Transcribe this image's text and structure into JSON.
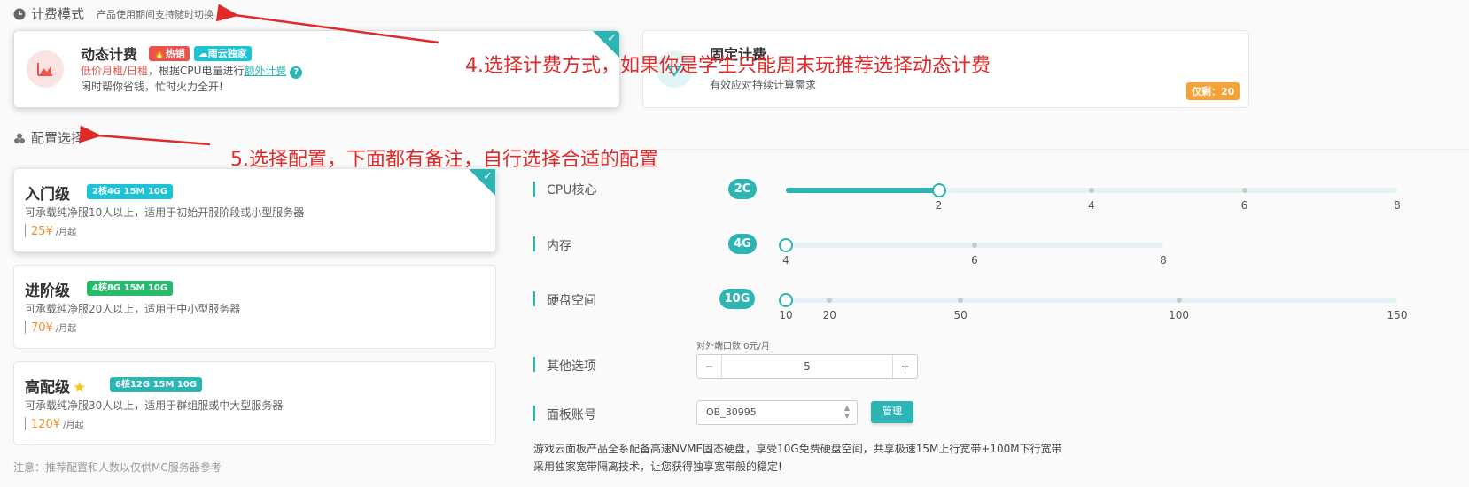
{
  "billing": {
    "title": "计费模式",
    "subtitle": "产品使用期间支持随时切换",
    "dynamic": {
      "name": "动态计费",
      "hot_tag": "热销",
      "exclusive_tag": "雨云独家",
      "desc_red": "低价月租/日租",
      "desc_mid": "，根据CPU电量进行",
      "desc_link": "额外计费",
      "tagline": "闲时帮你省钱，忙时火力全开!"
    },
    "fixed": {
      "name": "固定计费",
      "desc": "有效应对持续计算需求",
      "remain_badge": "仅剩：20"
    }
  },
  "config": {
    "title": "配置选择",
    "tiers": [
      {
        "name": "入门级",
        "spec": "2核4G 15M 10G",
        "desc": "可承载纯净服10人以上，适用于初始开服阶段或小型服务器",
        "price": "25¥",
        "unit": "/月起"
      },
      {
        "name": "进阶级",
        "spec": "4核8G 15M 10G",
        "desc": "可承载纯净服20人以上，适用于中小型服务器",
        "price": "70¥",
        "unit": "/月起"
      },
      {
        "name": "高配级",
        "spec": "6核12G 15M 10G",
        "desc": "可承载纯净服30人以上，适用于群组服或中大型服务器",
        "price": "120¥",
        "unit": "/月起"
      }
    ],
    "note": "注意：推荐配置和人数以仅供MC服务器参考"
  },
  "sliders": {
    "cpu": {
      "label": "CPU核心",
      "value_label": "2C",
      "value": 2,
      "min": 0,
      "max": 8,
      "ticks": [
        "2",
        "4",
        "6",
        "8"
      ]
    },
    "memory": {
      "label": "内存",
      "value_label": "4G",
      "value": 4,
      "min": 4,
      "max": 8,
      "ticks": [
        "4",
        "6",
        "8"
      ]
    },
    "disk": {
      "label": "硬盘空间",
      "value_label": "10G",
      "value": 10,
      "min": 10,
      "max": 150,
      "ticks": [
        "10",
        "20",
        "50",
        "100",
        "150"
      ]
    }
  },
  "other": {
    "label": "其他选项",
    "port_label": "对外端口数 0元/月",
    "port_value": "5",
    "minus": "−",
    "plus": "+"
  },
  "panel": {
    "label": "面板账号",
    "account": "OB_30995",
    "manage": "管理"
  },
  "footer": {
    "line1": "游戏云面板产品全系配备高速NVME固态硬盘，享受10G免费硬盘空间，共享极速15M上行宽带+100M下行宽带",
    "line2": "采用独家宽带隔离技术，让您获得独享宽带般的稳定!"
  },
  "annotations": {
    "step4": "4.选择计费方式，如果你是学生只能周末玩推荐选择动态计费",
    "step5": "5.选择配置，下面都有备注，自行选择合适的配置"
  },
  "colors": {
    "accent": "#2cb5b3",
    "price": "#f0932b",
    "annotation": "#e02a2a",
    "hot": "#e8524f",
    "badge": "#f7a234"
  }
}
